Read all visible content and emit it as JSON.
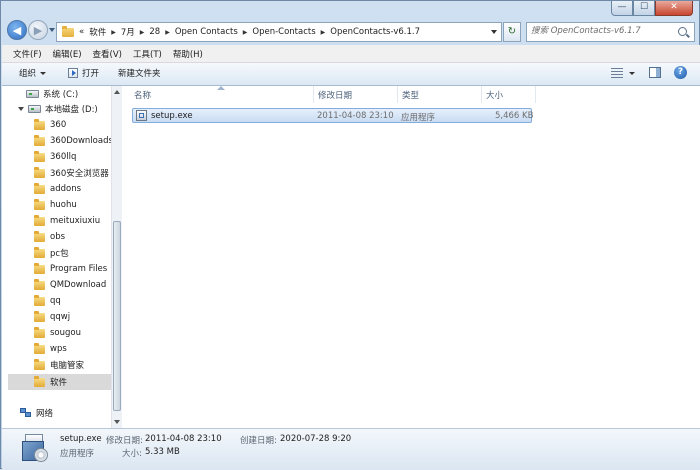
{
  "breadcrumb": [
    "«",
    "软件",
    "7月",
    "28",
    "Open Contacts",
    "Open-Contacts",
    "OpenContacts-v6.1.7"
  ],
  "search": {
    "placeholder": "搜索 OpenContacts-v6.1.7"
  },
  "window_controls": {
    "minimize": "—",
    "maximize": "☐",
    "close": "✕"
  },
  "menu": [
    "文件(F)",
    "编辑(E)",
    "查看(V)",
    "工具(T)",
    "帮助(H)"
  ],
  "commands": {
    "organize": "组织",
    "open": "打开",
    "new_folder": "新建文件夹"
  },
  "nav_tree": [
    {
      "label": "系统 (C:)",
      "kind": "drive",
      "expander": false
    },
    {
      "label": "本地磁盘 (D:)",
      "kind": "drive",
      "expander": true
    },
    {
      "label": "360",
      "kind": "folder"
    },
    {
      "label": "360Downloads",
      "kind": "folder"
    },
    {
      "label": "360llq",
      "kind": "folder"
    },
    {
      "label": "360安全浏览器",
      "kind": "folder"
    },
    {
      "label": "addons",
      "kind": "folder"
    },
    {
      "label": "huohu",
      "kind": "folder"
    },
    {
      "label": "meituxiuxiu",
      "kind": "folder"
    },
    {
      "label": "obs",
      "kind": "folder"
    },
    {
      "label": "pc包",
      "kind": "folder"
    },
    {
      "label": "Program Files",
      "kind": "folder"
    },
    {
      "label": "QMDownload",
      "kind": "folder"
    },
    {
      "label": "qq",
      "kind": "folder"
    },
    {
      "label": "qqwj",
      "kind": "folder"
    },
    {
      "label": "sougou",
      "kind": "folder"
    },
    {
      "label": "wps",
      "kind": "folder"
    },
    {
      "label": "电脑管家",
      "kind": "folder"
    },
    {
      "label": "软件",
      "kind": "folder",
      "selected": true
    }
  ],
  "network": "网络",
  "columns": {
    "name": "名称",
    "modified": "修改日期",
    "type": "类型",
    "size": "大小"
  },
  "files": [
    {
      "name": "setup.exe",
      "modified": "2011-04-08 23:10",
      "type": "应用程序",
      "size": "5,466 KB"
    }
  ],
  "details": {
    "filename": "setup.exe",
    "modified_label": "修改日期:",
    "modified_value": "2011-04-08 23:10",
    "created_label": "创建日期:",
    "created_value": "2020-07-28 9:20",
    "type": "应用程序",
    "size_label": "大小:",
    "size_value": "5.33 MB"
  },
  "colors": {
    "accent": "#2e6cc1",
    "selection": "#c9dcf3",
    "chrome": "#c9d9ea"
  }
}
